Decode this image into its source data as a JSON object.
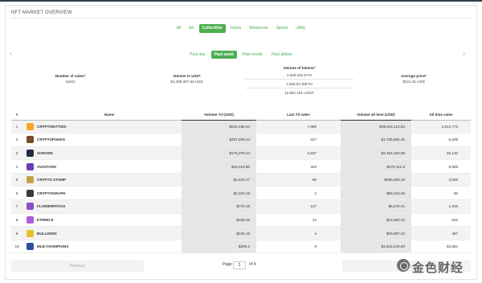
{
  "page": {
    "title": "NFT MARKET OVERVIEW"
  },
  "category_tabs": [
    "All",
    "Art",
    "Collectible",
    "Game",
    "Metaverse",
    "Sports",
    "Utility"
  ],
  "category_active": "Collectible",
  "period_tabs": [
    "Past day",
    "Past week",
    "Past month",
    "Past alltime"
  ],
  "period_active": "Past week",
  "nav": {
    "prev_arrow": "‹",
    "next_arrow": "›"
  },
  "stats": {
    "sales_label": "Number of sales*",
    "sales_value": "11611",
    "volume_usd_label": "Volume in USD*",
    "volume_usd_value": "$1,408,487.32 USD",
    "tokens_label": "Volume of tokens*",
    "tokens": [
      "2,549.224 ETH",
      "1,535.62 WETH",
      "12,881.181 USDT"
    ],
    "avg_price_label": "Average price*",
    "avg_price_value": "$121.31 USD"
  },
  "table": {
    "headers": [
      "#",
      "",
      "Name",
      "Volume 7d (USD)",
      "Last 7d sales",
      "Volume all time (USD)",
      "All time sales"
    ],
    "rows": [
      {
        "num": "1",
        "icon": "cryptokitties-icon",
        "color": "#f5a623",
        "name": "CRYPTOKITTIES",
        "vol7d": "$910,196.64",
        "sales7d": "7,980",
        "vol_all": "$38,541,113.52",
        "sales_all": "2,812,773"
      },
      {
        "num": "2",
        "icon": "cryptopunks-icon",
        "color": "#7a4a2a",
        "name": "CRYPTOPUNKS",
        "vol7d": "$287,209.24",
        "sales7d": "227",
        "vol_all": "$1,755,682.45",
        "sales_all": "5,208"
      },
      {
        "num": "3",
        "icon": "sorare-icon",
        "color": "#1f2a44",
        "name": "SORARE",
        "vol7d": "$175,378.44",
        "sales7d": "2,837",
        "vol_all": "$2,494,493.89",
        "sales_all": "46,136"
      },
      {
        "num": "4",
        "icon": "avastars-icon",
        "color": "#6a3fb5",
        "name": "AVASTARS",
        "vol7d": "$18,210.86",
        "sales7d": "262",
        "vol_all": "$478,112.8",
        "sales_all": "9,688"
      },
      {
        "num": "5",
        "icon": "crypto-stamp-icon",
        "color": "#c4a24a",
        "name": "CRYPTO STAMP",
        "vol7d": "$4,440.27",
        "sales7d": "95",
        "vol_all": "$366,268.46",
        "sales_all": "4,538"
      },
      {
        "num": "6",
        "icon": "cryptograph-icon",
        "color": "#3a3a3a",
        "name": "CRYPTOGRAPH",
        "vol7d": "$2,103.18",
        "sales7d": "2",
        "vol_all": "$99,342.26",
        "sales_all": "58"
      },
      {
        "num": "7",
        "icon": "flowerpatch-icon",
        "color": "#8a4fc9",
        "name": "FLOWERPATCH",
        "vol7d": "$772.18",
        "sales7d": "137",
        "vol_all": "$6,676.41",
        "sales_all": "1,916"
      },
      {
        "num": "8",
        "icon": "ethmoji-icon",
        "color": "#b05ad9",
        "name": "ETHMOJI",
        "vol7d": "$246.25",
        "sales7d": "14",
        "vol_all": "$16,582.43",
        "sales_all": "916"
      },
      {
        "num": "9",
        "icon": "bullionix-icon",
        "color": "#e6c229",
        "name": "BULLIONIX",
        "vol7d": "$240.19",
        "sales7d": "4",
        "vol_all": "$25,897.42",
        "sales_all": "487"
      },
      {
        "num": "10",
        "icon": "mlb-champions-icon",
        "color": "#2c4f9e",
        "name": "MLB CHAMPIONS",
        "vol7d": "$195.2",
        "sales7d": "8",
        "vol_all": "$1,516,343.80",
        "sales_all": "63,564"
      }
    ]
  },
  "pager": {
    "prev_label": "Previous",
    "page_label": "Page",
    "page_value": "1",
    "of_label": "of 4",
    "next_label": "Next"
  },
  "watermark": {
    "text": "金色财经"
  },
  "colors": {
    "accent": "#4caf50",
    "header_bar": "#2f3e4a"
  }
}
